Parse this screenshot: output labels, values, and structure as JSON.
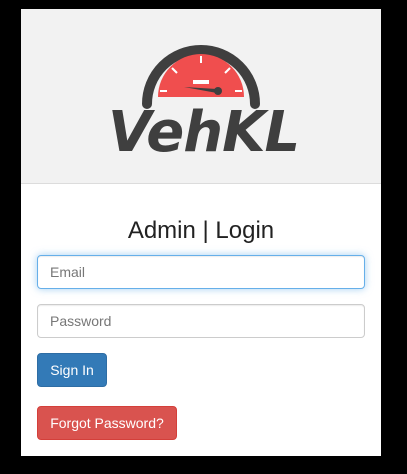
{
  "logo": {
    "brand": "VehKL",
    "icon": "speedometer-icon"
  },
  "login": {
    "title": "Admin | Login",
    "email_placeholder": "Email",
    "password_placeholder": "Password",
    "sign_in_label": "Sign In",
    "forgot_label": "Forgot Password?"
  },
  "colors": {
    "gauge_red": "#f04e4e",
    "gauge_dark": "#3f3f3f",
    "primary": "#337ab7",
    "danger": "#d9534f",
    "focus": "#66afe9"
  }
}
